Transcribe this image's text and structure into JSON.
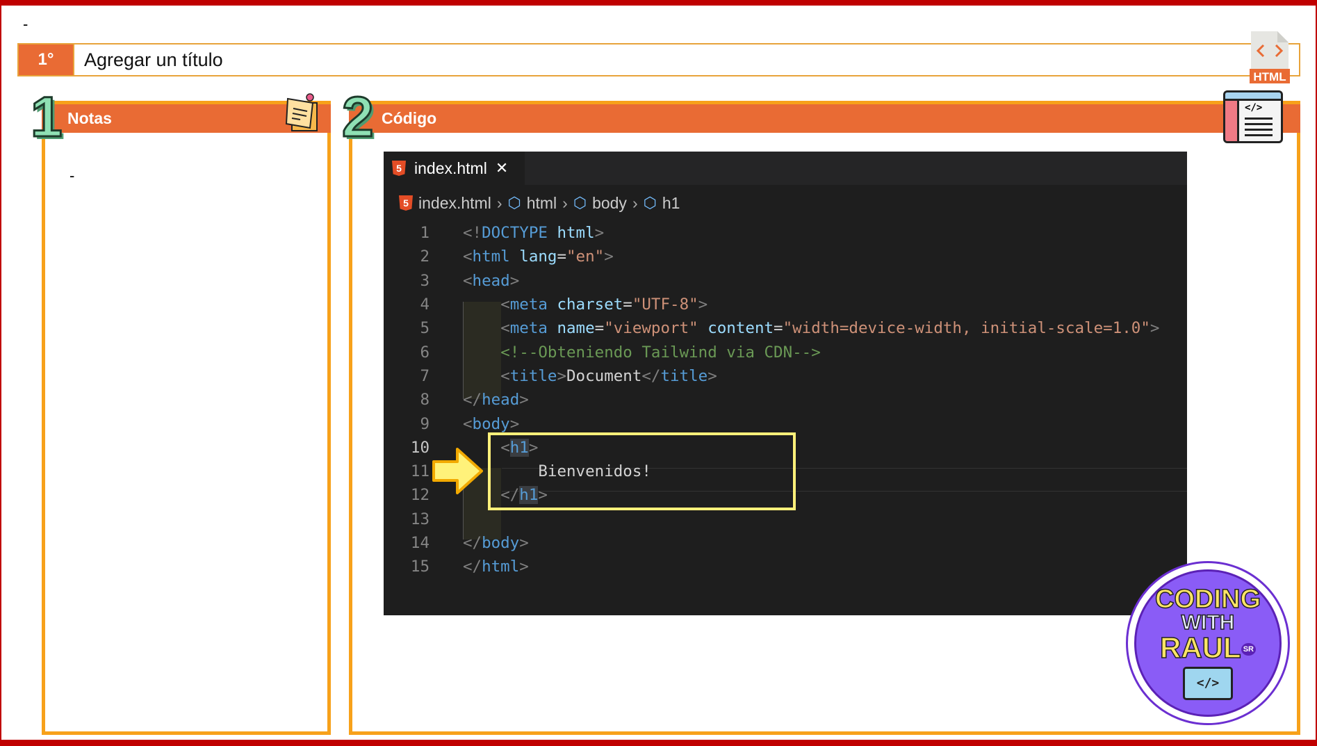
{
  "header": {
    "dash": "-",
    "step": "1°",
    "title": "Agregar un título"
  },
  "panels": {
    "notes": {
      "number": "1",
      "title": "Notas",
      "content": "-"
    },
    "code": {
      "number": "2",
      "title": "Código"
    }
  },
  "icons": {
    "html_file_label": "HTML",
    "code_doc_label": "</>"
  },
  "editor": {
    "tab_label": "index.html",
    "tab_close": "✕",
    "html5_glyph": "5",
    "breadcrumb": [
      "index.html",
      "html",
      "body",
      "h1"
    ],
    "lines": [
      [
        [
          "b",
          "<!"
        ],
        [
          "t",
          "DOCTYPE"
        ],
        [
          "x",
          " "
        ],
        [
          "a",
          "html"
        ],
        [
          "b",
          ">"
        ]
      ],
      [
        [
          "b",
          "<"
        ],
        [
          "t",
          "html"
        ],
        [
          "x",
          " "
        ],
        [
          "a",
          "lang"
        ],
        [
          "x",
          "="
        ],
        [
          "s",
          "\"en\""
        ],
        [
          "b",
          ">"
        ]
      ],
      [
        [
          "b",
          "<"
        ],
        [
          "t",
          "head"
        ],
        [
          "b",
          ">"
        ]
      ],
      [
        [
          "x",
          "    "
        ],
        [
          "b",
          "<"
        ],
        [
          "t",
          "meta"
        ],
        [
          "x",
          " "
        ],
        [
          "a",
          "charset"
        ],
        [
          "x",
          "="
        ],
        [
          "s",
          "\"UTF-8\""
        ],
        [
          "b",
          ">"
        ]
      ],
      [
        [
          "x",
          "    "
        ],
        [
          "b",
          "<"
        ],
        [
          "t",
          "meta"
        ],
        [
          "x",
          " "
        ],
        [
          "a",
          "name"
        ],
        [
          "x",
          "="
        ],
        [
          "s",
          "\"viewport\""
        ],
        [
          "x",
          " "
        ],
        [
          "a",
          "content"
        ],
        [
          "x",
          "="
        ],
        [
          "s",
          "\"width=device-width, initial-scale=1.0\""
        ],
        [
          "b",
          ">"
        ]
      ],
      [
        [
          "x",
          "    "
        ],
        [
          "c",
          "<!--Obteniendo Tailwind via CDN-->"
        ]
      ],
      [
        [
          "x",
          "    "
        ],
        [
          "b",
          "<"
        ],
        [
          "t",
          "title"
        ],
        [
          "b",
          ">"
        ],
        [
          "x",
          "Document"
        ],
        [
          "b",
          "</"
        ],
        [
          "t",
          "title"
        ],
        [
          "b",
          ">"
        ]
      ],
      [
        [
          "b",
          "</"
        ],
        [
          "t",
          "head"
        ],
        [
          "b",
          ">"
        ]
      ],
      [
        [
          "b",
          "<"
        ],
        [
          "t",
          "body"
        ],
        [
          "b",
          ">"
        ]
      ],
      [
        [
          "x",
          "    "
        ],
        [
          "b",
          "<"
        ],
        [
          "t hl",
          "h1"
        ],
        [
          "b",
          ">"
        ]
      ],
      [
        [
          "x",
          "        Bienvenidos!"
        ]
      ],
      [
        [
          "x",
          "    "
        ],
        [
          "b",
          "</"
        ],
        [
          "t hl",
          "h1"
        ],
        [
          "b",
          ">"
        ]
      ],
      [
        [
          "x",
          ""
        ]
      ],
      [
        [
          "b",
          "</"
        ],
        [
          "t",
          "body"
        ],
        [
          "b",
          ">"
        ]
      ],
      [
        [
          "b",
          "</"
        ],
        [
          "t",
          "html"
        ],
        [
          "b",
          ">"
        ]
      ]
    ],
    "current_line": 10
  },
  "logo": {
    "line1": "CODING",
    "line2": "WITH",
    "line3": "RAUL",
    "badge": "SR"
  },
  "colors": {
    "accent": "#e96b34",
    "border": "#f7a11a",
    "frame": "#c00000",
    "highlight": "#fff07a"
  }
}
